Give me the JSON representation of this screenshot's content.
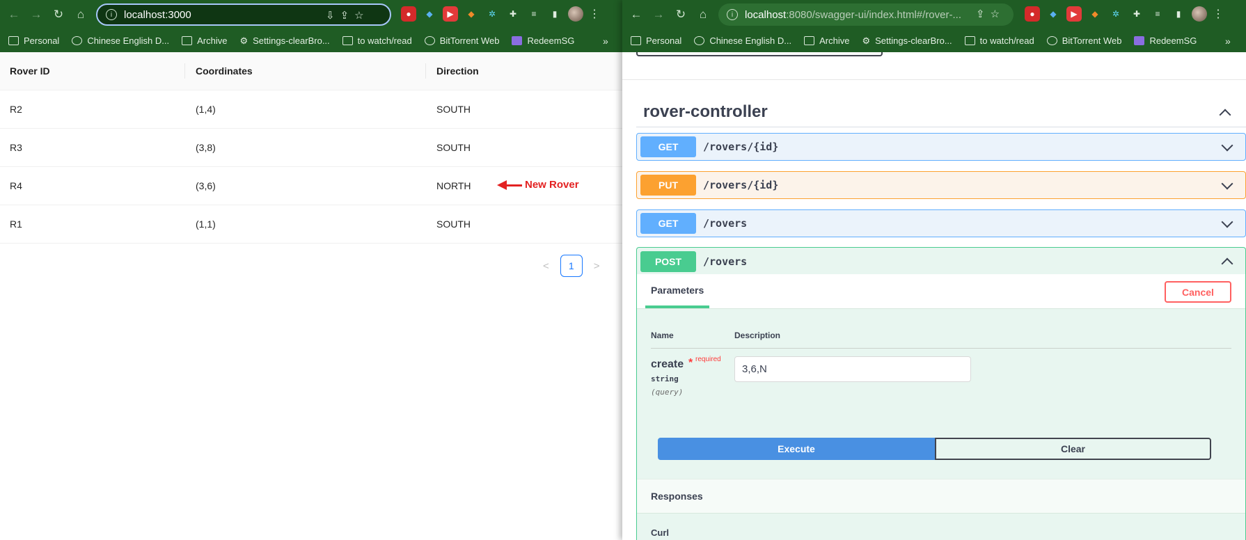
{
  "left_window": {
    "url": "localhost:3000",
    "bookmarks": [
      "Personal",
      "Chinese English D...",
      "Archive",
      "Settings-clearBro...",
      "to watch/read",
      "BitTorrent Web",
      "RedeemSG"
    ],
    "more": "»",
    "table": {
      "headers": [
        "Rover ID",
        "Coordinates",
        "Direction"
      ],
      "rows": [
        {
          "id": "R2",
          "coordinates": "(1,4)",
          "direction": "SOUTH"
        },
        {
          "id": "R3",
          "coordinates": "(3,8)",
          "direction": "SOUTH"
        },
        {
          "id": "R4",
          "coordinates": "(3,6)",
          "direction": "NORTH"
        },
        {
          "id": "R1",
          "coordinates": "(1,1)",
          "direction": "SOUTH"
        }
      ]
    },
    "annotation": "New Rover",
    "pagination": {
      "current_page": "1",
      "prev": "<",
      "next": ">"
    }
  },
  "right_window": {
    "url_host": "localhost",
    "url_rest": ":8080/swagger-ui/index.html#/rover-...",
    "bookmarks": [
      "Personal",
      "Chinese English D...",
      "Archive",
      "Settings-clearBro...",
      "to watch/read",
      "BitTorrent Web",
      "RedeemSG"
    ],
    "more": "»",
    "swagger": {
      "tag_title": "rover-controller",
      "operations": [
        {
          "method": "GET",
          "path": "/rovers/{id}"
        },
        {
          "method": "PUT",
          "path": "/rovers/{id}"
        },
        {
          "method": "GET",
          "path": "/rovers"
        },
        {
          "method": "POST",
          "path": "/rovers"
        }
      ],
      "parameters_tab": "Parameters",
      "cancel_label": "Cancel",
      "col_name": "Name",
      "col_description": "Description",
      "param": {
        "name": "create",
        "required_star": "*",
        "required_text": "required",
        "type": "string",
        "in": "(query)",
        "value": "3,6,N"
      },
      "execute_label": "Execute",
      "clear_label": "Clear",
      "responses_title": "Responses",
      "curl_label": "Curl"
    }
  },
  "colors": {
    "toolbar": "#1f5c24",
    "get": "#61affe",
    "put": "#fca130",
    "post": "#49cc90",
    "execute": "#4990e2",
    "annotation": "#e32222"
  }
}
